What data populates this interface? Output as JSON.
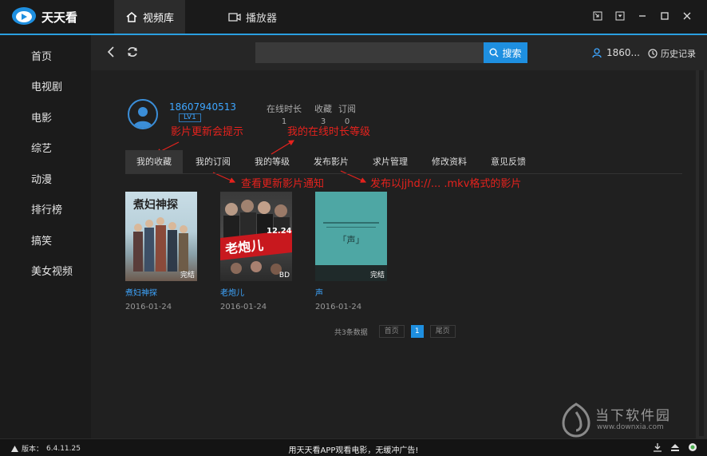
{
  "app": {
    "name": "天天看"
  },
  "tabs": [
    {
      "label": "视频库"
    },
    {
      "label": "播放器"
    }
  ],
  "sidebar": {
    "items": [
      {
        "label": "首页"
      },
      {
        "label": "电视剧"
      },
      {
        "label": "电影"
      },
      {
        "label": "综艺"
      },
      {
        "label": "动漫"
      },
      {
        "label": "排行榜"
      },
      {
        "label": "搞笑"
      },
      {
        "label": "美女视频"
      }
    ]
  },
  "search": {
    "placeholder": "",
    "button_label": "搜索"
  },
  "header": {
    "user_label": "1860...",
    "history_label": "历史记录"
  },
  "profile": {
    "username": "18607940513",
    "level": "LV1",
    "stats": [
      {
        "label": "在线时长",
        "value": "1"
      },
      {
        "label": "收藏",
        "value": "3"
      },
      {
        "label": "订阅",
        "value": "0"
      }
    ]
  },
  "annotations": {
    "update_notice": "影片更新会提示",
    "online_level": "我的在线时长等级",
    "subscription_notice": "查看更新影片通知",
    "publish_format": "发布以jjhd://... .mkv格式的影片"
  },
  "profile_tabs": [
    {
      "label": "我的收藏"
    },
    {
      "label": "我的订阅"
    },
    {
      "label": "我的等级"
    },
    {
      "label": "发布影片"
    },
    {
      "label": "求片管理"
    },
    {
      "label": "修改资料"
    },
    {
      "label": "意见反馈"
    }
  ],
  "movies": [
    {
      "title": "煮妇神探",
      "date": "2016-01-24",
      "tag": "完结",
      "poster_text": "煮妇神探"
    },
    {
      "title": "老炮儿",
      "date": "2016-01-24",
      "tag": "BD",
      "poster_text": "老炮儿",
      "poster_date": "12.24"
    },
    {
      "title": "声",
      "date": "2016-01-24",
      "tag": "完结",
      "poster_text": "「声」"
    }
  ],
  "pagination": {
    "count_text": "共3条数据",
    "first": "首页",
    "current": "1",
    "last": "尾页"
  },
  "watermark": {
    "text": "当下软件园",
    "url": "www.downxia.com"
  },
  "statusbar": {
    "version_label": "版本：",
    "version": "6.4.11.25",
    "promo": "用天天看APP观看电影，无缓冲广告!"
  },
  "colors": {
    "accent": "#1e8fe0",
    "link": "#3ea6ff",
    "annotation": "#e5221d",
    "background": "#202020",
    "sidebar": "#1b1b1b"
  }
}
